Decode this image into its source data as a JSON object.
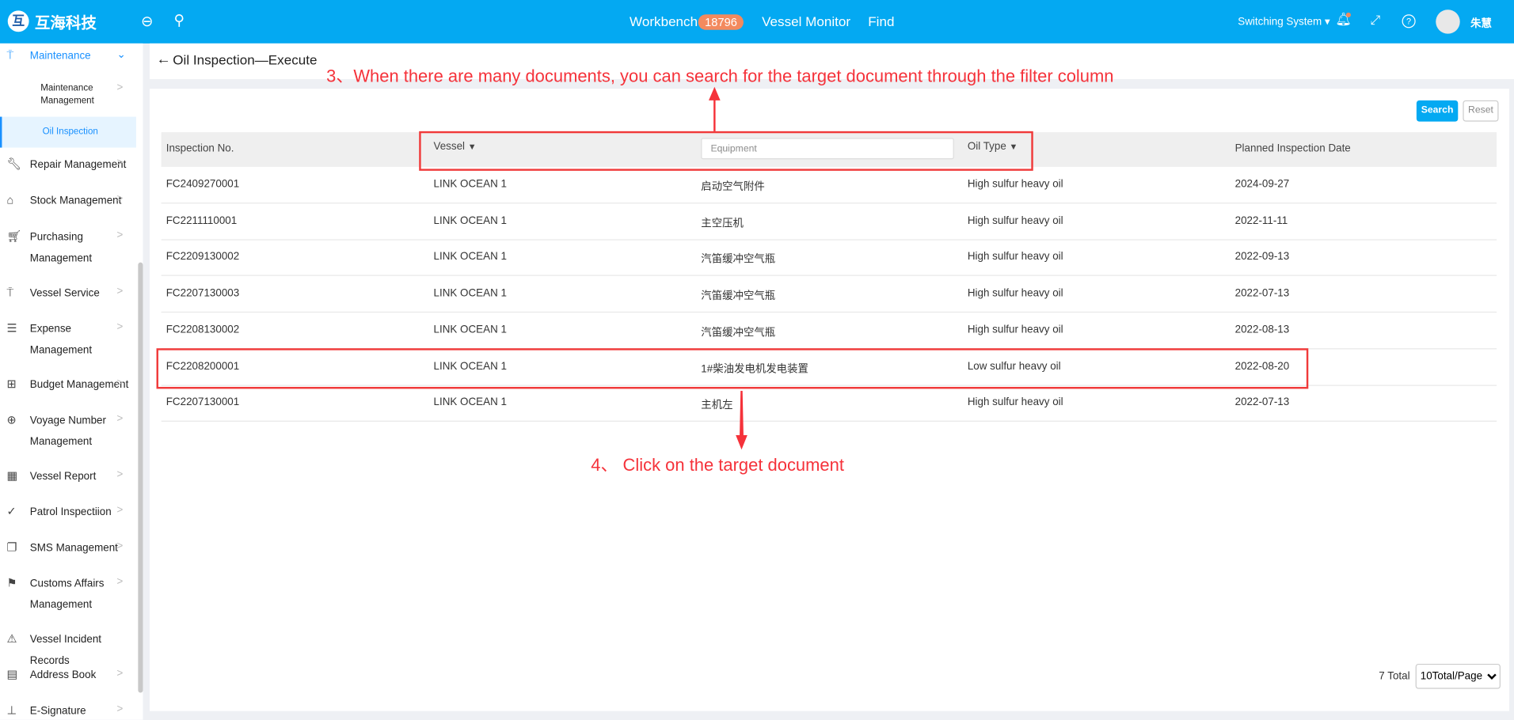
{
  "header": {
    "brand": "互海科技",
    "nav": [
      {
        "label": "Workbench",
        "badge": "18796"
      },
      {
        "label": "Vessel Monitor"
      },
      {
        "label": "Find"
      }
    ],
    "switch_system": "Switching System",
    "user_name": "朱慧",
    "accent": "#04a9f2"
  },
  "sidebar": {
    "items": [
      {
        "label": "Maintenance",
        "icon": "paint-roller-icon",
        "expanded": true
      },
      {
        "label": "Maintenance Management",
        "sub": true
      },
      {
        "label": "Oil Inspection",
        "sub": true,
        "active": true
      },
      {
        "label": "Repair Management",
        "icon": "wrench-icon"
      },
      {
        "label": "Stock Management",
        "icon": "home-icon"
      },
      {
        "label": "Purchasing Management",
        "icon": "cart-icon"
      },
      {
        "label": "Vessel Service",
        "icon": "paint-roller-icon"
      },
      {
        "label": "Expense Management",
        "icon": "database-icon"
      },
      {
        "label": "Budget Management",
        "icon": "calculator-icon"
      },
      {
        "label": "Voyage Number Management",
        "icon": "globe-icon"
      },
      {
        "label": "Vessel Report",
        "icon": "calendar-icon"
      },
      {
        "label": "Patrol Inspectiion",
        "icon": "check-circle-icon"
      },
      {
        "label": "SMS Management",
        "icon": "copy-icon"
      },
      {
        "label": "Customs Affairs Management",
        "icon": "signpost-icon"
      },
      {
        "label": "Vessel Incident Records",
        "icon": "warning-icon"
      },
      {
        "label": "Address Book",
        "icon": "address-book-icon"
      },
      {
        "label": "E-Signature",
        "icon": "stamp-icon"
      }
    ]
  },
  "page": {
    "title": "Oil Inspection—Execute",
    "search_label": "Search",
    "reset_label": "Reset",
    "equipment_placeholder": "Equipment"
  },
  "table": {
    "columns": [
      "Inspection No.",
      "Vessel",
      "Equipment",
      "Oil Type",
      "Planned Inspection Date"
    ],
    "rows": [
      [
        "FC2409270001",
        "LINK OCEAN 1",
        "启动空气附件",
        "High sulfur heavy oil",
        "2024-09-27"
      ],
      [
        "FC2211110001",
        "LINK OCEAN 1",
        "主空压机",
        "High sulfur heavy oil",
        "2022-11-11"
      ],
      [
        "FC2209130002",
        "LINK OCEAN 1",
        "汽笛缓冲空气瓶",
        "High sulfur heavy oil",
        "2022-09-13"
      ],
      [
        "FC2207130003",
        "LINK OCEAN 1",
        "汽笛缓冲空气瓶",
        "High sulfur heavy oil",
        "2022-07-13"
      ],
      [
        "FC2208130002",
        "LINK OCEAN 1",
        "汽笛缓冲空气瓶",
        "High sulfur heavy oil",
        "2022-08-13"
      ],
      [
        "FC2208200001",
        "LINK OCEAN 1",
        "1#柴油发电机发电装置",
        "Low sulfur heavy oil",
        "2022-08-20"
      ],
      [
        "FC2207130001",
        "LINK OCEAN 1",
        "主机左",
        "High sulfur heavy oil",
        "2022-07-13"
      ]
    ]
  },
  "pagination": {
    "total": "7 Total",
    "page_size": "10Total/Page"
  },
  "annotations": {
    "step3": "3、When there are many documents, you can search for the target document through the filter column",
    "step4": "4、 Click on the target document",
    "color": "#f5323a"
  }
}
